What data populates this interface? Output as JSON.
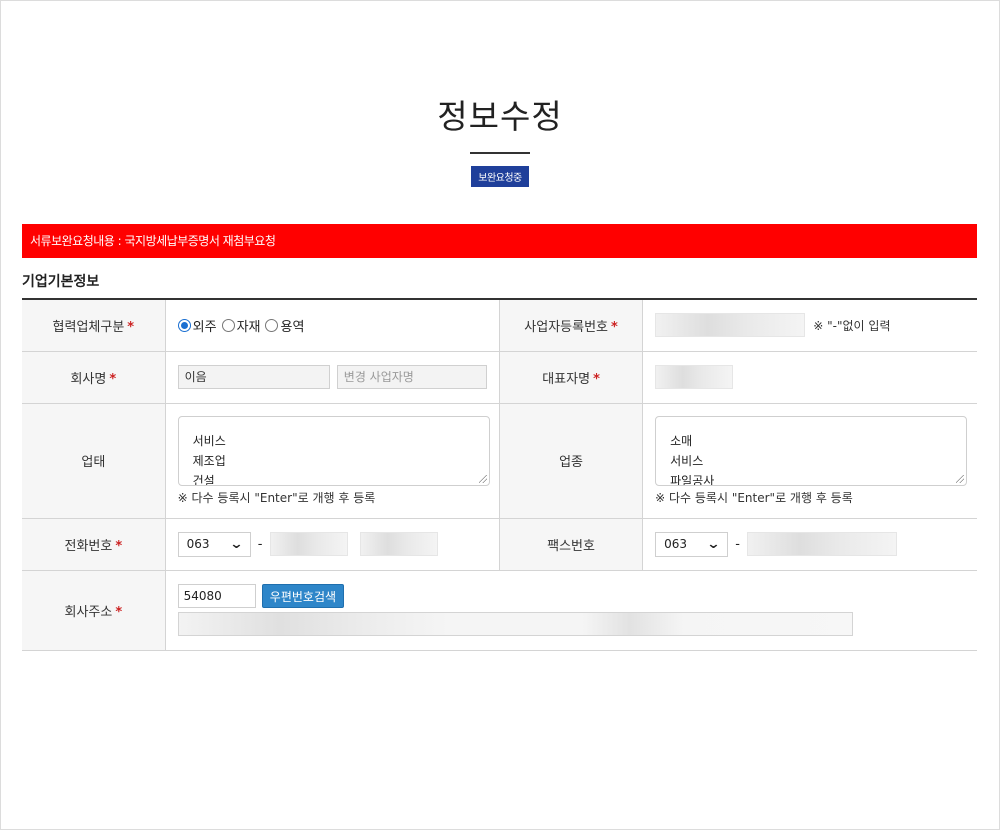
{
  "page": {
    "title": "정보수정",
    "status_badge": "보완요청중"
  },
  "alert": {
    "text": "서류보완요청내용 : 국지방세납부증명서 재첨부요청",
    "color": "#ff0000"
  },
  "section": {
    "title": "기업기본정보"
  },
  "form": {
    "partner_type": {
      "label": "협력업체구분",
      "options": [
        "외주",
        "자재",
        "용역"
      ],
      "selected": "외주"
    },
    "business_reg": {
      "label": "사업자등록번호",
      "hint": "※ \"-\"없이 입력"
    },
    "company_name": {
      "label": "회사명",
      "value": "이음",
      "change_placeholder": "변경 사업자명"
    },
    "ceo_name": {
      "label": "대표자명"
    },
    "business_type": {
      "label": "업태",
      "lines": [
        "서비스",
        "제조업",
        "건설"
      ],
      "note": "※ 다수 등록시 \"Enter\"로 개행 후 등록"
    },
    "business_item": {
      "label": "업종",
      "lines": [
        "소매",
        "서비스",
        "파일공사"
      ],
      "note": "※ 다수 등록시 \"Enter\"로 개행 후 등록"
    },
    "phone": {
      "label": "전화번호",
      "area_code": "063",
      "separator": "-"
    },
    "fax": {
      "label": "팩스번호",
      "area_code": "063",
      "separator": "-"
    },
    "address": {
      "label": "회사주소",
      "zipcode": "54080",
      "search_button": "우편번호검색"
    },
    "required_mark": "*"
  },
  "colors": {
    "badge": "#1f3f9a",
    "button": "#2e86c9",
    "required": "#cc2222"
  }
}
